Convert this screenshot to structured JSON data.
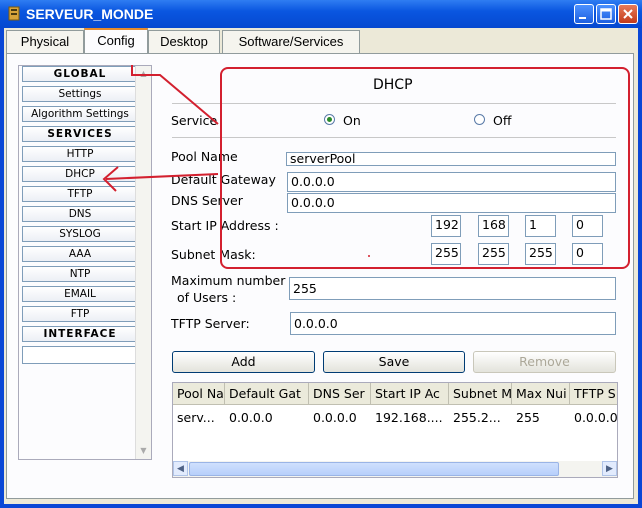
{
  "window": {
    "title": "SERVEUR_MONDE"
  },
  "tabs": [
    {
      "label": "Physical"
    },
    {
      "label": "Config"
    },
    {
      "label": "Desktop"
    },
    {
      "label": "Software/Services"
    }
  ],
  "sidebar": {
    "items": [
      {
        "label": "GLOBAL",
        "header": true
      },
      {
        "label": "Settings"
      },
      {
        "label": "Algorithm Settings"
      },
      {
        "label": "SERVICES",
        "header": true
      },
      {
        "label": "HTTP"
      },
      {
        "label": "DHCP"
      },
      {
        "label": "TFTP"
      },
      {
        "label": "DNS"
      },
      {
        "label": "SYSLOG"
      },
      {
        "label": "AAA"
      },
      {
        "label": "NTP"
      },
      {
        "label": "EMAIL"
      },
      {
        "label": "FTP"
      },
      {
        "label": "INTERFACE",
        "header": true
      }
    ]
  },
  "dhcp": {
    "title": "DHCP",
    "service_label": "Service",
    "on_label": "On",
    "off_label": "Off",
    "service_state": "On",
    "pool_name_label": "Pool Name",
    "pool_name": "serverPool",
    "default_gateway_label": "Default Gateway",
    "default_gateway": "0.0.0.0",
    "dns_server_label": "DNS Server",
    "dns_server": "0.0.0.0",
    "start_ip_label": "Start IP Address :",
    "start_ip": [
      "192",
      "168",
      "1",
      "0"
    ],
    "subnet_mask_label": "Subnet Mask:",
    "subnet_mask": [
      "255",
      "255",
      "255",
      "0"
    ],
    "max_users_label_1": "Maximum number",
    "max_users_label_2": "of Users :",
    "max_users": "255",
    "tftp_server_label": "TFTP Server:",
    "tftp_server": "0.0.0.0",
    "buttons": {
      "add": "Add",
      "save": "Save",
      "remove": "Remove"
    }
  },
  "table": {
    "headers": [
      "Pool Na",
      "Default Gat",
      "DNS Ser",
      "Start IP Ac",
      "Subnet M",
      "Max Nui",
      "TFTP S"
    ],
    "rows": [
      [
        "serv...",
        "0.0.0.0",
        "0.0.0.0",
        "192.168....",
        "255.2...",
        "255",
        "0.0.0.0"
      ]
    ]
  },
  "colors": {
    "annotation": "#d3202f",
    "tab_accent": "#e68b2c",
    "titlebar": "#0a56e0"
  }
}
